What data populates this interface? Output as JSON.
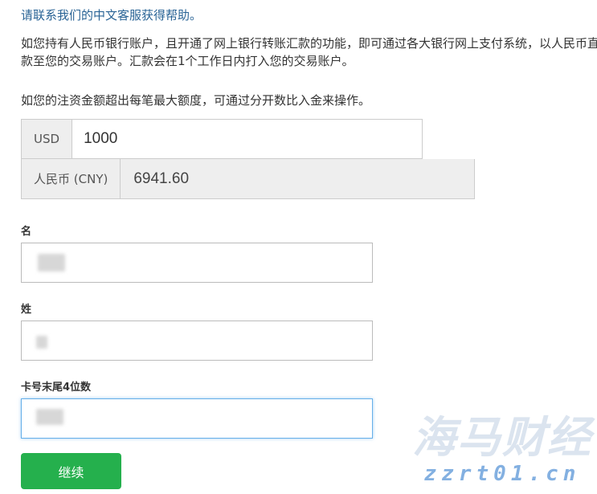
{
  "intro": {
    "contact_link": "请联系我们的中文客服获得帮助。",
    "paragraph": "如您持有人民币银行账户，且开通了网上银行转账汇款的功能，即可通过各大银行网上支付系统，以人民币直接汇款至您的交易账户。汇款会在1个工作日内打入您的交易账户。",
    "split_note": "如您的注资金额超出每笔最大额度，可通过分开数比入金来操作。"
  },
  "currency": {
    "usd_label": "USD",
    "usd_value": "1000",
    "cny_label": "人民币 (CNY)",
    "cny_value": "6941.60"
  },
  "form": {
    "first_name_label": "名",
    "last_name_label": "姓",
    "card_last4_label": "卡号末尾4位数",
    "submit_label": "继续"
  },
  "watermark": {
    "cn": "海马财经",
    "en": "zzrt01.cn"
  }
}
